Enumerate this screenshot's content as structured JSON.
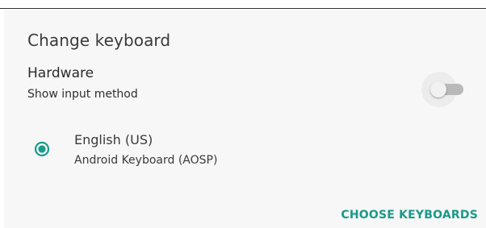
{
  "dialog": {
    "title": "Change keyboard",
    "hardware": {
      "title": "Hardware",
      "subtitle": "Show input method",
      "switch_on": false
    },
    "input_methods": [
      {
        "name": "English (US)",
        "description": "Android Keyboard (AOSP)",
        "selected": true
      }
    ],
    "actions": {
      "choose_keyboards_label": "CHOOSE KEYBOARDS"
    }
  },
  "colors": {
    "accent": "#1a9a8a",
    "dialog_background": "#f7f7f7",
    "switch_track_off": "#b9b9b9",
    "switch_thumb_off": "#f1f1f1"
  },
  "icons": {
    "radio": "radio-button-checked-icon"
  }
}
